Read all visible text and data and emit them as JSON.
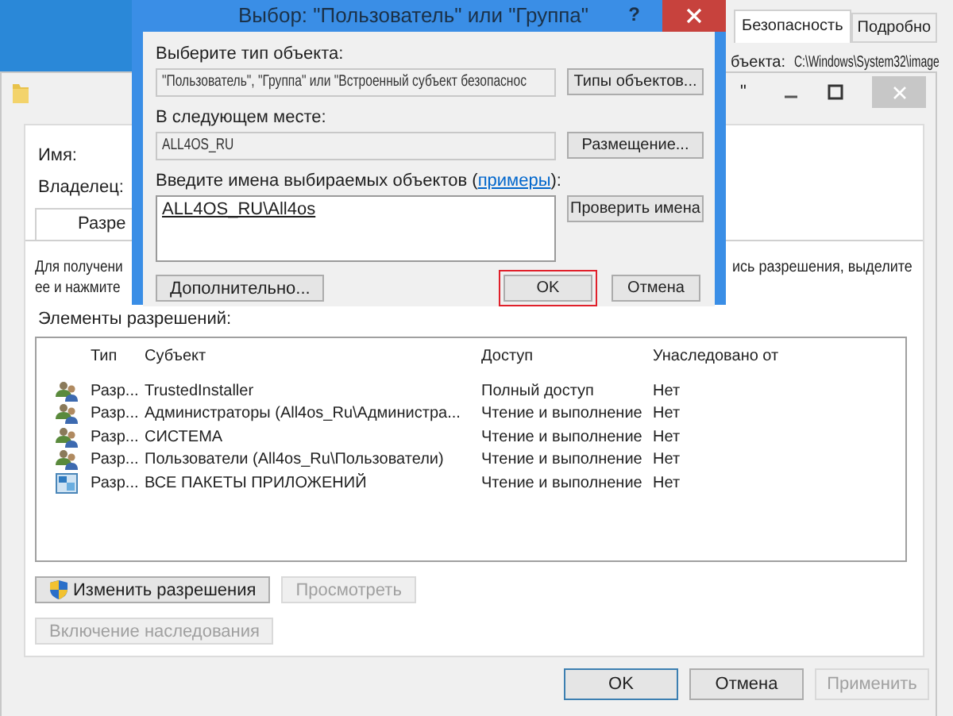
{
  "properties_window": {
    "tabs": [
      {
        "label": "Безопасность",
        "selected": true
      },
      {
        "label": "Подробно",
        "selected": false
      }
    ],
    "object_label": "бъекта:",
    "object_path": "C:\\Windows\\System32\\image"
  },
  "advanced_window": {
    "title_fragment": "\"",
    "name_label": "Имя:",
    "owner_label": "Владелец:",
    "tab": "Разре",
    "instruction_left": [
      "Для получени",
      "ее и нажмите"
    ],
    "instruction_right": "ись разрешения, выделите",
    "entries_label": "Элементы разрешений:",
    "table": {
      "columns": [
        "Тип",
        "Субъект",
        "Доступ",
        "Унаследовано от"
      ],
      "rows": [
        {
          "kind": "group",
          "type": "Разр...",
          "subject": "TrustedInstaller",
          "access": "Полный доступ",
          "inherited": "Нет"
        },
        {
          "kind": "group",
          "type": "Разр...",
          "subject": "Администраторы (All4os_Ru\\Администра...",
          "access": "Чтение и выполнение",
          "inherited": "Нет"
        },
        {
          "kind": "group",
          "type": "Разр...",
          "subject": "СИСТЕМА",
          "access": "Чтение и выполнение",
          "inherited": "Нет"
        },
        {
          "kind": "group",
          "type": "Разр...",
          "subject": "Пользователи (All4os_Ru\\Пользователи)",
          "access": "Чтение и выполнение",
          "inherited": "Нет"
        },
        {
          "kind": "package",
          "type": "Разр...",
          "subject": "ВСЕ ПАКЕТЫ ПРИЛОЖЕНИЙ",
          "access": "Чтение и выполнение",
          "inherited": "Нет"
        }
      ]
    },
    "actions": [
      {
        "label": "Изменить разрешения",
        "disabled": false,
        "kind": "shield"
      },
      {
        "label": "Просмотреть",
        "disabled": true,
        "kind": "plain"
      }
    ],
    "inherit_button": {
      "label": "Включение наследования",
      "disabled": true
    },
    "footer": [
      {
        "label": "OK",
        "disabled": false,
        "default": true
      },
      {
        "label": "Отмена",
        "disabled": false,
        "default": false
      },
      {
        "label": "Применить",
        "disabled": true,
        "default": false
      }
    ]
  },
  "dialog": {
    "title": "Выбор: \"Пользователь\" или \"Группа\"",
    "help": "?",
    "fields": [
      {
        "label": "Выберите тип объекта:",
        "value": "\"Пользователь\", \"Группа\" или \"Встроенный субъект безопаснос",
        "button": "Типы объектов..."
      },
      {
        "label": "В следующем месте:",
        "value": "ALL4OS_RU",
        "button": "Размещение..."
      }
    ],
    "names": {
      "label_before": "Введите имена выбираемых объектов (",
      "link": "примеры",
      "label_after": "):",
      "value": "ALL4OS_RU\\All4os",
      "button": "Проверить имена"
    },
    "advanced_button": "Дополнительно...",
    "buttons": [
      {
        "label": "OK",
        "highlighted": true
      },
      {
        "label": "Отмена",
        "highlighted": false
      }
    ]
  }
}
